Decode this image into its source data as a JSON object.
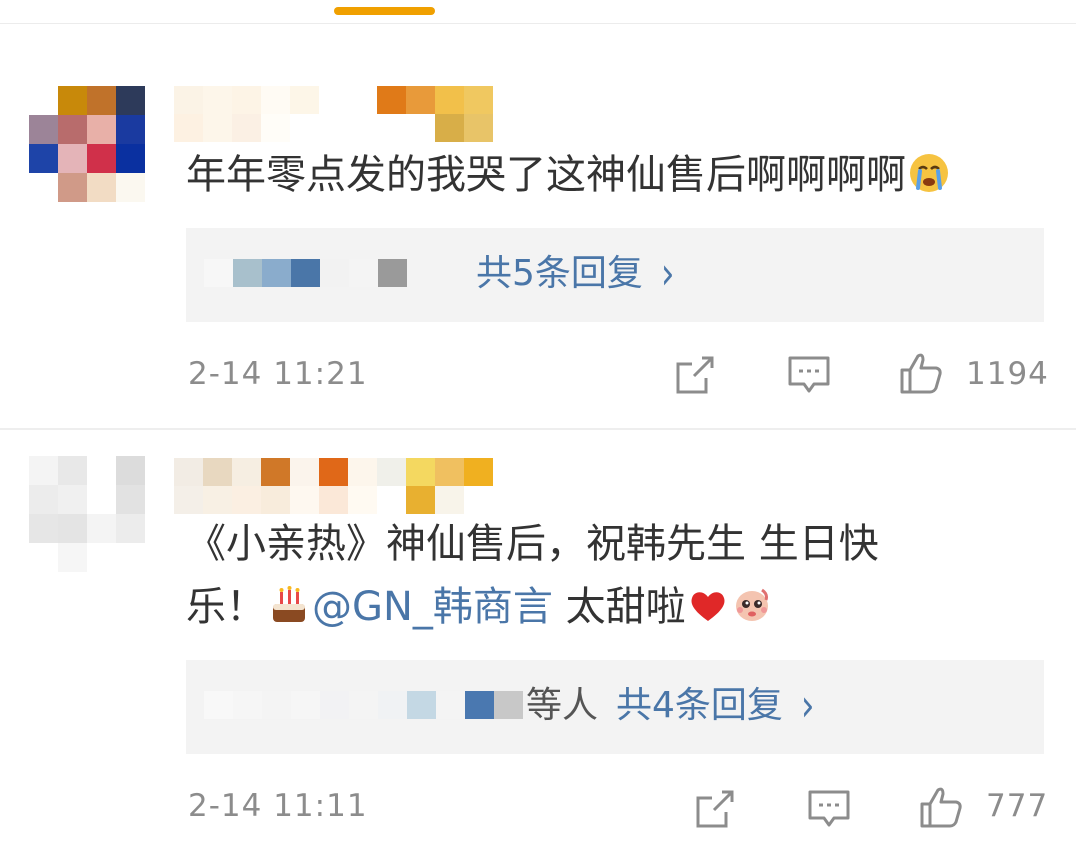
{
  "colors": {
    "accent": "#f0a000",
    "link": "#4a76a8",
    "text": "#333333",
    "muted": "#8c8c8c",
    "reply_bg": "#f3f3f3"
  },
  "comments": [
    {
      "text": "年年零点发的我哭了这神仙售后啊啊啊啊",
      "emoji_end": "crying-face-emoji",
      "replies_label": "共5条回复",
      "time": "2-14 11:21",
      "likes": "1194"
    },
    {
      "text_line1": "《小亲热》神仙售后，祝韩先生 生日快",
      "text_line2_pre": "乐！",
      "emoji_cake": "birthday-cake-emoji",
      "mention": "@GN_韩商言",
      "text_line2_post": " 太甜啦",
      "emoji_heart": "red-heart-emoji",
      "emoji_sticker": "cute-character-emoji",
      "reply_suffix": "等人",
      "replies_label": "共4条回复",
      "time": "2-14 11:11",
      "likes": "777"
    }
  ],
  "icons": {
    "share": "share-icon",
    "comment": "comment-icon",
    "like": "thumbs-up-icon",
    "chevron": "chevron-right-icon"
  }
}
